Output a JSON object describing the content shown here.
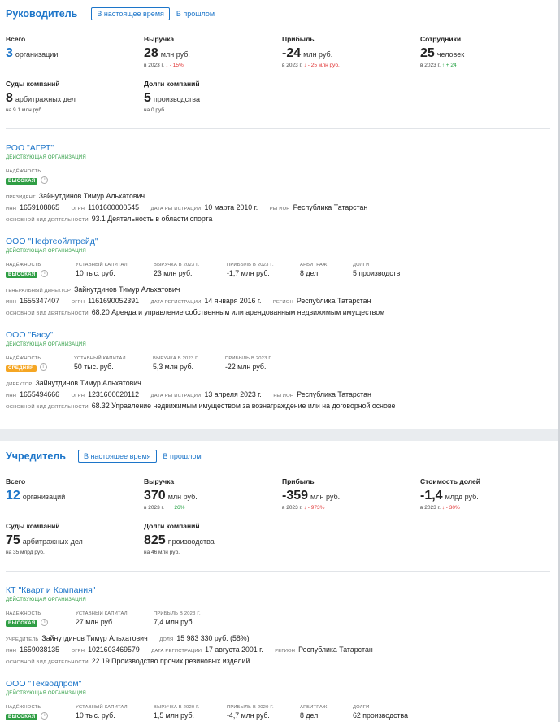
{
  "leader": {
    "title": "Руководитель",
    "tab_current": "В настоящее время",
    "tab_past": "В прошлом",
    "stats": [
      {
        "label": "Всего",
        "value": "3",
        "unit": "организации",
        "sub": "",
        "delta": "",
        "dir": ""
      },
      {
        "label": "Выручка",
        "value": "28",
        "unit": "млн руб.",
        "sub": "в 2023 г.",
        "delta": "- 15%",
        "dir": "down"
      },
      {
        "label": "Прибыль",
        "value": "-24",
        "unit": "млн руб.",
        "sub": "в 2023 г.",
        "delta": "- 25 млн руб.",
        "dir": "down"
      },
      {
        "label": "Сотрудники",
        "value": "25",
        "unit": "человек",
        "sub": "в 2023 г.",
        "delta": "+ 24",
        "dir": "up"
      },
      {
        "label": "Суды компаний",
        "value": "8",
        "unit": "арбитражных дел",
        "sub": "на 9.1 млн руб.",
        "delta": "",
        "dir": ""
      },
      {
        "label": "Долги компаний",
        "value": "5",
        "unit": "производства",
        "sub": "на 0 руб.",
        "delta": "",
        "dir": ""
      }
    ],
    "orgs": [
      {
        "name": "РОО \"АГРТ\"",
        "status": "ДЕЙСТВУЮЩАЯ ОРГАНИЗАЦИЯ",
        "reliability_label": "НАДЁЖНОСТЬ",
        "reliability": "ВЫСОКАЯ",
        "person_role": "ПРЕЗИДЕНТ",
        "person": "Зайнутдинов Тимур Альхатович",
        "inn_label": "ИНН",
        "inn": "1659108865",
        "ogrn_label": "ОГРН",
        "ogrn": "1101600000545",
        "reg_label": "ДАТА РЕГИСТРАЦИИ",
        "reg": "10 марта 2010 г.",
        "region_label": "РЕГИОН",
        "region": "Республика Татарстан",
        "activity_label": "ОСНОВНОЙ ВИД ДЕЯТЕЛЬНОСТИ",
        "activity": "93.1 Деятельность в области спорта"
      },
      {
        "name": "ООО \"Нефтеойлтрейд\"",
        "status": "ДЕЙСТВУЮЩАЯ ОРГАНИЗАЦИЯ",
        "reliability_label": "НАДЁЖНОСТЬ",
        "reliability": "ВЫСОКАЯ",
        "metrics": [
          {
            "label": "УСТАВНЫЙ КАПИТАЛ",
            "value": "10 тыс. руб."
          },
          {
            "label": "ВЫРУЧКА В 2023 Г.",
            "value": "23 млн руб."
          },
          {
            "label": "ПРИБЫЛЬ В 2023 Г.",
            "value": "-1,7 млн руб."
          },
          {
            "label": "АРБИТРАЖ",
            "value": "8 дел"
          },
          {
            "label": "ДОЛГИ",
            "value": "5 производств"
          }
        ],
        "person_role": "ГЕНЕРАЛЬНЫЙ ДИРЕКТОР",
        "person": "Зайнутдинов Тимур Альхатович",
        "inn_label": "ИНН",
        "inn": "1655347407",
        "ogrn_label": "ОГРН",
        "ogrn": "1161690052391",
        "reg_label": "ДАТА РЕГИСТРАЦИИ",
        "reg": "14 января 2016 г.",
        "region_label": "РЕГИОН",
        "region": "Республика Татарстан",
        "activity_label": "ОСНОВНОЙ ВИД ДЕЯТЕЛЬНОСТИ",
        "activity": "68.20 Аренда и управление собственным или арендованным недвижимым имуществом"
      },
      {
        "name": "ООО \"Басу\"",
        "status": "ДЕЙСТВУЮЩАЯ ОРГАНИЗАЦИЯ",
        "reliability_label": "НАДЁЖНОСТЬ",
        "reliability": "СРЕДНЯЯ",
        "metrics": [
          {
            "label": "УСТАВНЫЙ КАПИТАЛ",
            "value": "50 тыс. руб."
          },
          {
            "label": "ВЫРУЧКА В 2023 Г.",
            "value": "5,3 млн руб."
          },
          {
            "label": "ПРИБЫЛЬ В 2023 Г.",
            "value": "-22 млн руб."
          }
        ],
        "person_role": "ДИРЕКТОР",
        "person": "Зайнутдинов Тимур Альхатович",
        "inn_label": "ИНН",
        "inn": "1655494666",
        "ogrn_label": "ОГРН",
        "ogrn": "1231600020112",
        "reg_label": "ДАТА РЕГИСТРАЦИИ",
        "reg": "13 апреля 2023 г.",
        "region_label": "РЕГИОН",
        "region": "Республика Татарстан",
        "activity_label": "ОСНОВНОЙ ВИД ДЕЯТЕЛЬНОСТИ",
        "activity": "68.32 Управление недвижимым имуществом за вознаграждение или на договорной основе"
      }
    ]
  },
  "founder": {
    "title": "Учредитель",
    "tab_current": "В настоящее время",
    "tab_past": "В прошлом",
    "stats": [
      {
        "label": "Всего",
        "value": "12",
        "unit": "организаций",
        "sub": "",
        "delta": "",
        "dir": ""
      },
      {
        "label": "Выручка",
        "value": "370",
        "unit": "млн руб.",
        "sub": "в 2023 г.",
        "delta": "+ 26%",
        "dir": "up"
      },
      {
        "label": "Прибыль",
        "value": "-359",
        "unit": "млн руб.",
        "sub": "в 2023 г.",
        "delta": "- 973%",
        "dir": "down"
      },
      {
        "label": "Стоимость долей",
        "value": "-1,4",
        "unit": "млрд руб.",
        "sub": "в 2023 г.",
        "delta": "- 30%",
        "dir": "down"
      },
      {
        "label": "Суды компаний",
        "value": "75",
        "unit": "арбитражных дел",
        "sub": "на 35 млрд руб.",
        "delta": "",
        "dir": ""
      },
      {
        "label": "Долги компаний",
        "value": "825",
        "unit": "производства",
        "sub": "на 46 млн руб.",
        "delta": "",
        "dir": ""
      }
    ],
    "orgs": [
      {
        "name": "КТ \"Кварт и Компания\"",
        "status": "ДЕЙСТВУЮЩАЯ ОРГАНИЗАЦИЯ",
        "reliability_label": "НАДЁЖНОСТЬ",
        "reliability": "ВЫСОКАЯ",
        "metrics": [
          {
            "label": "УСТАВНЫЙ КАПИТАЛ",
            "value": "27 млн руб."
          },
          {
            "label": "ПРИБЫЛЬ В 2023 Г.",
            "value": "7,4 млн руб."
          }
        ],
        "person_role": "УЧРЕДИТЕЛЬ",
        "person": "Зайнутдинов Тимур Альхатович",
        "share_label": "ДОЛЯ",
        "share": "15 983 330 руб. (58%)",
        "inn_label": "ИНН",
        "inn": "1659038135",
        "ogrn_label": "ОГРН",
        "ogrn": "1021603469579",
        "reg_label": "ДАТА РЕГИСТРАЦИИ",
        "reg": "17 августа 2001 г.",
        "region_label": "РЕГИОН",
        "region": "Республика Татарстан",
        "activity_label": "ОСНОВНОЙ ВИД ДЕЯТЕЛЬНОСТИ",
        "activity": "22.19 Производство прочих резиновых изделий"
      },
      {
        "name": "ООО \"Техводпром\"",
        "status": "ДЕЙСТВУЮЩАЯ ОРГАНИЗАЦИЯ",
        "reliability_label": "НАДЁЖНОСТЬ",
        "reliability": "ВЫСОКАЯ",
        "metrics": [
          {
            "label": "УСТАВНЫЙ КАПИТАЛ",
            "value": "10 тыс. руб."
          },
          {
            "label": "ВЫРУЧКА В 2020 Г.",
            "value": "1,5 млн руб."
          },
          {
            "label": "ПРИБЫЛЬ В 2020 Г.",
            "value": "-4,7 млн руб."
          },
          {
            "label": "АРБИТРАЖ",
            "value": "8 дел"
          },
          {
            "label": "ДОЛГИ",
            "value": "62 производства"
          }
        ]
      }
    ]
  },
  "colors": {
    "accent": "#1c75c9",
    "green": "#2f9e44",
    "orange": "#f5a623",
    "red": "#e03131"
  }
}
